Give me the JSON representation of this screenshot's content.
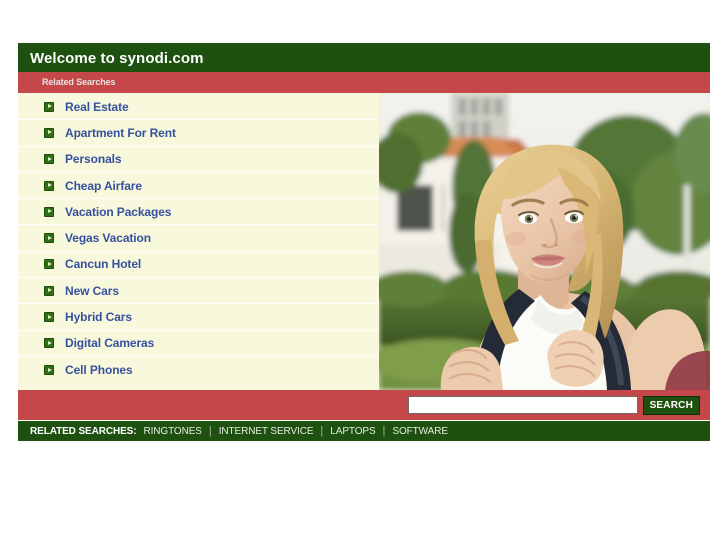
{
  "header": {
    "title": "Welcome to synodi.com",
    "bg_color": "#1e5110",
    "text_color": "#ffffff"
  },
  "subheader": {
    "label": "Related Searches",
    "bg_color": "#c4474a",
    "text_color": "#e9e3e3"
  },
  "related_links": [
    {
      "label": "Real Estate",
      "icon": "green-arrow-bullet-icon"
    },
    {
      "label": "Apartment For Rent",
      "icon": "green-arrow-bullet-icon"
    },
    {
      "label": "Personals",
      "icon": "green-arrow-bullet-icon"
    },
    {
      "label": "Cheap Airfare",
      "icon": "green-arrow-bullet-icon"
    },
    {
      "label": "Vacation Packages",
      "icon": "green-arrow-bullet-icon"
    },
    {
      "label": "Vegas Vacation",
      "icon": "green-arrow-bullet-icon"
    },
    {
      "label": "Cancun Hotel",
      "icon": "green-arrow-bullet-icon"
    },
    {
      "label": "New Cars",
      "icon": "green-arrow-bullet-icon"
    },
    {
      "label": "Hybrid Cars",
      "icon": "green-arrow-bullet-icon"
    },
    {
      "label": "Digital Cameras",
      "icon": "green-arrow-bullet-icon"
    },
    {
      "label": "Cell Phones",
      "icon": "green-arrow-bullet-icon"
    }
  ],
  "link_colors": {
    "text": "#36519e",
    "panel_bg": "#f8f8dc"
  },
  "photo": {
    "alt": "Smiling young blonde woman wearing a backpack outdoors in front of a white building with a terracotta roof and green hedges"
  },
  "search": {
    "value": "",
    "placeholder": "",
    "button_label": "SEARCH",
    "button_bg": "#1e5110"
  },
  "footer": {
    "title": "RELATED SEARCHES:",
    "separator": "|",
    "links": [
      "RINGTONES",
      "INTERNET SERVICE",
      "LAPTOPS",
      "SOFTWARE"
    ],
    "bg_color": "#1e5110"
  }
}
